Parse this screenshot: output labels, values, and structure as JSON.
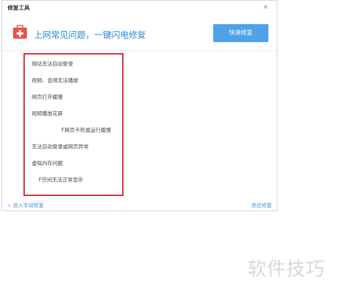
{
  "window": {
    "title": "修复工具",
    "close_glyph": "×"
  },
  "header": {
    "icon": "medical-toolbox-icon",
    "headline": "上网常见问题，一键闪电修复",
    "quick_fix_label": "快速修复"
  },
  "issues": [
    "网站无法自动登录",
    "视频、音频无法播放",
    "网页打开缓慢",
    "视频播放花屏",
    "F网页卡死或运行缓慢",
    "无法自动登录或网页异常",
    "虚拟内存问题",
    "F空间无法正常显示"
  ],
  "footer": {
    "left_glyph": "«",
    "left_label": "进入手动修复",
    "right_label": "退出修复"
  },
  "watermark": "软件技巧",
  "colors": {
    "accent": "#2b8ad6",
    "button": "#4ea3e8",
    "highlight_box": "#d92b33",
    "icon_red": "#e8534a"
  }
}
